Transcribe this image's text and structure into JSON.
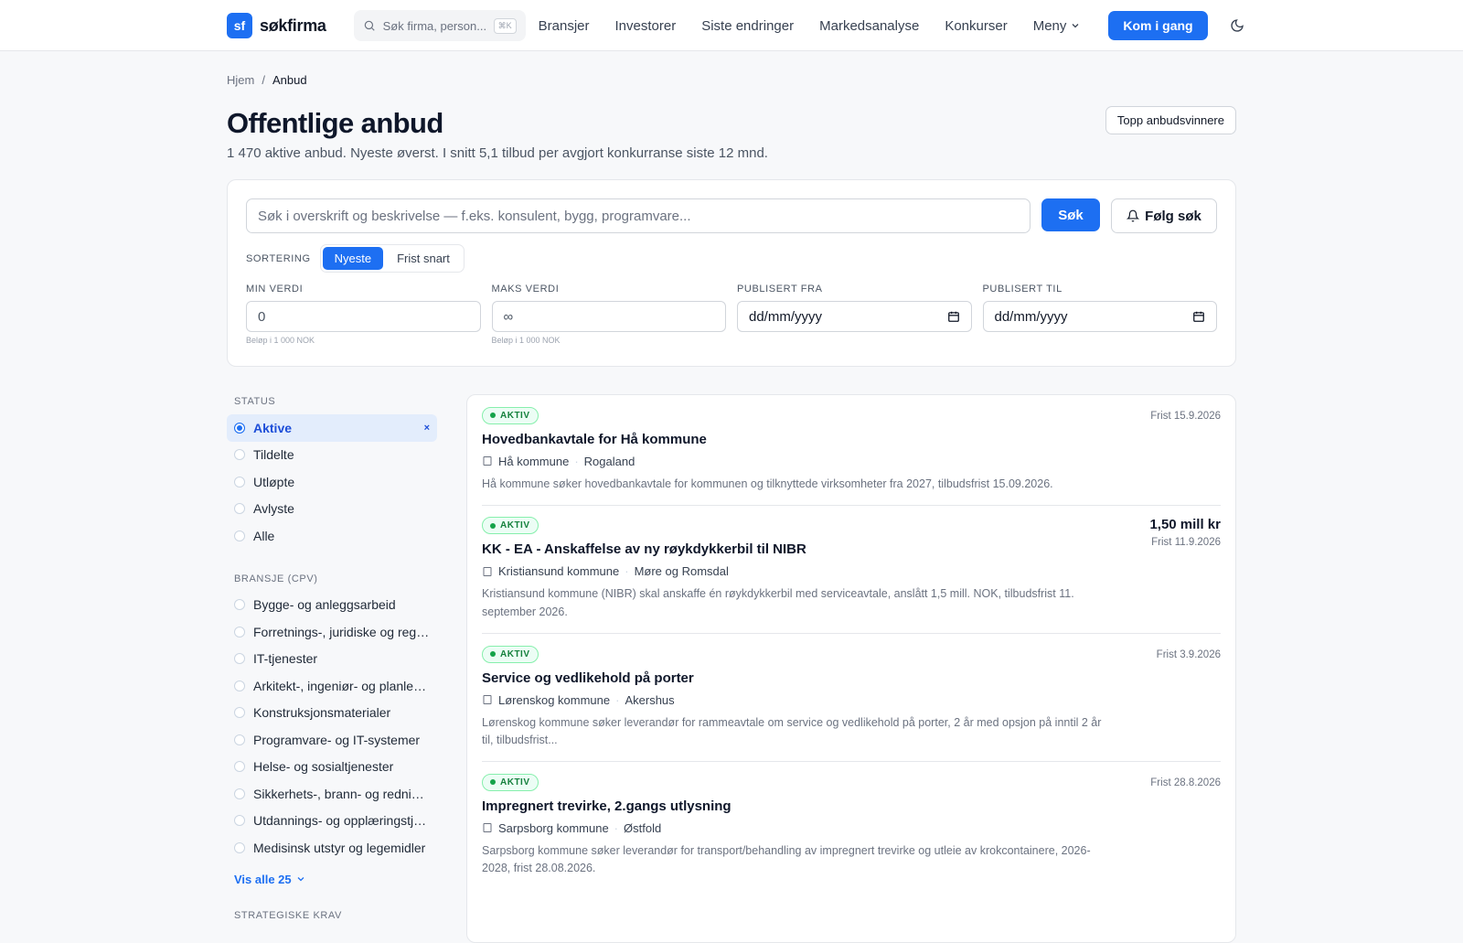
{
  "app": {
    "logo_mark": "sf",
    "logo_text": "søkfirma",
    "search_placeholder": "Søk firma, person...",
    "search_kbd": "⌘K",
    "nav": [
      "Bransjer",
      "Investorer",
      "Siste endringer",
      "Markedsanalyse",
      "Konkurser"
    ],
    "menu_label": "Meny",
    "cta_label": "Kom i gang"
  },
  "breadcrumb": {
    "home": "Hjem",
    "sep": "/",
    "current": "Anbud"
  },
  "page": {
    "title": "Offentlige anbud",
    "subtitle": "1 470 aktive anbud. Nyeste øverst. I snitt 5,1 tilbud per avgjort konkurranse siste 12 mnd.",
    "top_button": "Topp anbudsvinnere"
  },
  "search": {
    "placeholder": "Søk i overskrift og beskrivelse — f.eks. konsulent, bygg, programvare...",
    "submit_label": "Søk",
    "follow_label": "Følg søk",
    "sort_label": "SORTERING",
    "sort_options": [
      "Nyeste",
      "Frist snart"
    ],
    "filters": {
      "min": {
        "label": "MIN VERDI",
        "value": "0",
        "hint": "Beløp i 1 000 NOK"
      },
      "max": {
        "label": "MAKS VERDI",
        "value": "∞",
        "hint": "Beløp i 1 000 NOK"
      },
      "from": {
        "label": "PUBLISERT FRA",
        "value": "dd/mm/yyyy"
      },
      "to": {
        "label": "PUBLISERT TIL",
        "value": "dd/mm/yyyy"
      }
    }
  },
  "sidebar": {
    "status_head": "STATUS",
    "status": [
      "Aktive",
      "Tildelte",
      "Utløpte",
      "Avlyste",
      "Alle"
    ],
    "clear_label": "×",
    "bransje_head": "BRANSJE (CPV)",
    "bransjer": [
      "Bygge- og anleggsarbeid",
      "Forretnings-, juridiske og regns...",
      "IT-tjenester",
      "Arkitekt-, ingeniør- og planleg...",
      "Konstruksjonsmaterialer",
      "Programvare- og IT-systemer",
      "Helse- og sosialtjenester",
      "Sikkerhets-, brann- og redning...",
      "Utdannings- og opplæringstje...",
      "Medisinsk utstyr og legemidler"
    ],
    "more_label": "Vis alle 25",
    "next_head": "STRATEGISKE KRAV"
  },
  "results": [
    {
      "badge": "AKTIV",
      "title": "Hovedbankavtale for Hå kommune",
      "org": "Hå kommune",
      "region": "Rogaland",
      "desc": "Hå kommune søker hovedbankavtale for kommunen og tilknyttede virksomheter fra 2027, tilbudsfrist 15.09.2026.",
      "amount": "",
      "frist": "Frist 15.9.2026"
    },
    {
      "badge": "AKTIV",
      "title": "KK - EA - Anskaffelse av ny røykdykkerbil til NIBR",
      "org": "Kristiansund kommune",
      "region": "Møre og Romsdal",
      "desc": "Kristiansund kommune (NIBR) skal anskaffe én røykdykkerbil med serviceavtale, anslått 1,5 mill. NOK, tilbudsfrist 11. september 2026.",
      "amount": "1,50 mill kr",
      "frist": "Frist 11.9.2026"
    },
    {
      "badge": "AKTIV",
      "title": "Service og vedlikehold på porter",
      "org": "Lørenskog kommune",
      "region": "Akershus",
      "desc": "Lørenskog kommune søker leverandør for rammeavtale om service og vedlikehold på porter, 2 år med opsjon på inntil 2 år til, tilbudsfrist...",
      "amount": "",
      "frist": "Frist 3.9.2026"
    },
    {
      "badge": "AKTIV",
      "title": "Impregnert trevirke, 2.gangs utlysning",
      "org": "Sarpsborg kommune",
      "region": "Østfold",
      "desc": "Sarpsborg kommune søker leverandør for transport/behandling av impregnert trevirke og utleie av krokcontainere, 2026-2028, frist 28.08.2026.",
      "amount": "",
      "frist": "Frist 28.8.2026"
    }
  ],
  "colors": {
    "accent": "#1d6ff2",
    "status_green": "#16a34a"
  }
}
